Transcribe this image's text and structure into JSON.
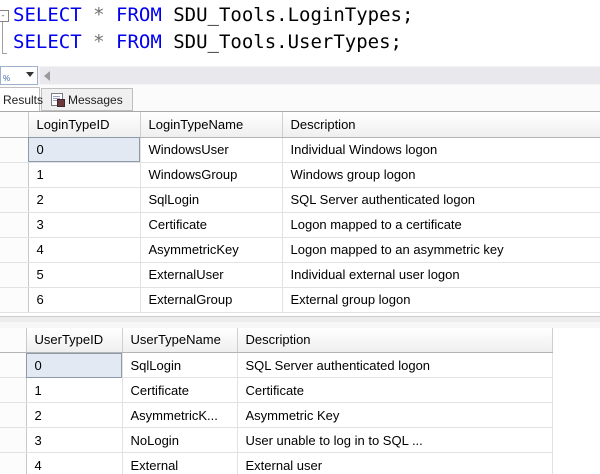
{
  "editor": {
    "line1": {
      "kw_select": "SELECT",
      "star": "*",
      "kw_from": "FROM",
      "object": "SDU_Tools.LoginTypes;"
    },
    "line2": {
      "kw_select": "SELECT",
      "star": "*",
      "kw_from": "FROM",
      "object": "SDU_Tools.UserTypes;"
    },
    "collapse_glyph": "-",
    "keyword_color": "#0000ee",
    "operator_color": "#707070"
  },
  "tabs": {
    "results": "Results",
    "messages": "Messages"
  },
  "grid1": {
    "columns": [
      "LoginTypeID",
      "LoginTypeName",
      "Description"
    ],
    "rows": [
      [
        "0",
        "WindowsUser",
        "Individual Windows logon"
      ],
      [
        "1",
        "WindowsGroup",
        "Windows group logon"
      ],
      [
        "2",
        "SqlLogin",
        "SQL Server authenticated logon"
      ],
      [
        "3",
        "Certificate",
        "Logon mapped to a certificate"
      ],
      [
        "4",
        "AsymmetricKey",
        "Logon mapped to an asymmetric key"
      ],
      [
        "5",
        "ExternalUser",
        "Individual external user logon"
      ],
      [
        "6",
        "ExternalGroup",
        "External group logon"
      ]
    ],
    "selected_cell_value": "0"
  },
  "grid2": {
    "columns": [
      "UserTypeID",
      "UserTypeName",
      "Description"
    ],
    "rows": [
      [
        "0",
        "SqlLogin",
        "SQL Server authenticated logon"
      ],
      [
        "1",
        "Certificate",
        "Certificate"
      ],
      [
        "2",
        "AsymmetricK...",
        "Asymmetric Key"
      ],
      [
        "3",
        "NoLogin",
        "User unable to log in to SQL ..."
      ],
      [
        "4",
        "External",
        "External user"
      ]
    ],
    "selected_cell_value": "0"
  },
  "colors": {
    "selection_bg": "#e3e9f3",
    "selection_border": "#8e99a9"
  }
}
